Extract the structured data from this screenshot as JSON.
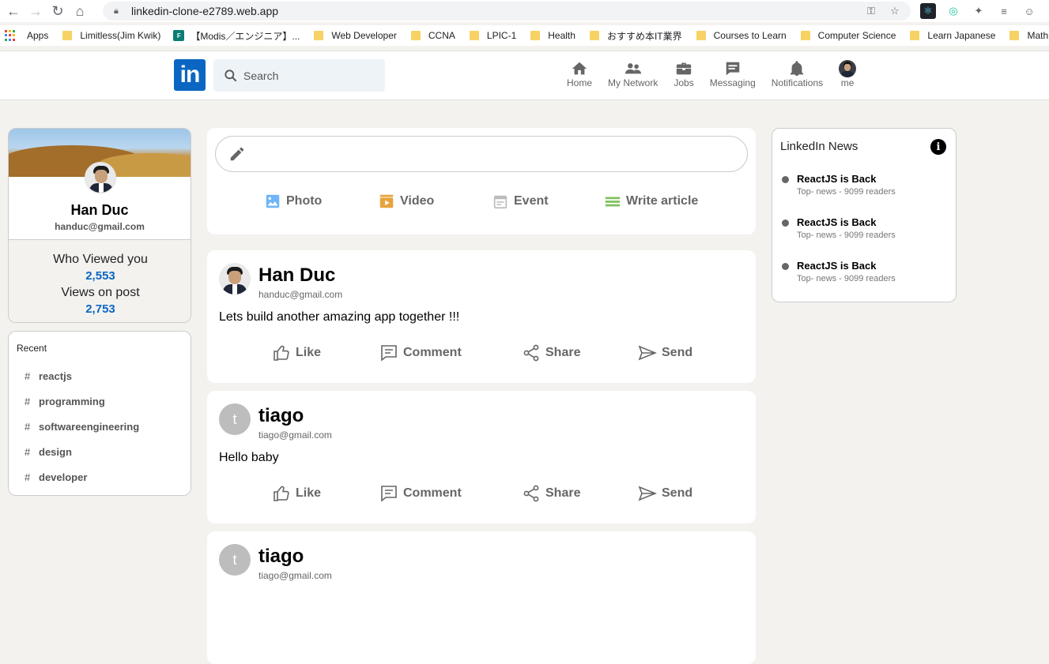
{
  "browser": {
    "url": "linkedin-clone-e2789.web.app",
    "bookmarks": [
      "Apps",
      "Limitless(Jim Kwik)",
      "【Modis／エンジニア】...",
      "Web Developer",
      "CCNA",
      "LPIC-1",
      "Health",
      "おすすめ本IT業界",
      "Courses to Learn",
      "Computer Science",
      "Learn Japanese",
      "Math"
    ]
  },
  "header": {
    "logo": "in",
    "search_placeholder": "Search",
    "nav": [
      {
        "label": "Home",
        "icon": "home-icon"
      },
      {
        "label": "My Network",
        "icon": "network-icon"
      },
      {
        "label": "Jobs",
        "icon": "briefcase-icon"
      },
      {
        "label": "Messaging",
        "icon": "message-icon"
      },
      {
        "label": "Notifications",
        "icon": "bell-icon"
      },
      {
        "label": "me",
        "icon": "avatar"
      }
    ]
  },
  "profile": {
    "name": "Han Duc",
    "email": "handuc@gmail.com",
    "who_viewed_label": "Who Viewed you",
    "who_viewed_count": "2,553",
    "views_label": "Views on post",
    "views_count": "2,753"
  },
  "recent": {
    "title": "Recent",
    "tags": [
      "reactjs",
      "programming",
      "softwareengineering",
      "design",
      "developer"
    ]
  },
  "composer": {
    "input_value": "",
    "options": [
      "Photo",
      "Video",
      "Event",
      "Write article"
    ]
  },
  "posts": [
    {
      "author": "Han Duc",
      "email": "handuc@gmail.com",
      "message": "Lets build another amazing app together !!!",
      "avatar_letter": ""
    },
    {
      "author": "tiago",
      "email": "tiago@gmail.com",
      "message": "Hello baby",
      "avatar_letter": "t"
    },
    {
      "author": "tiago",
      "email": "tiago@gmail.com",
      "message": "",
      "avatar_letter": "t"
    }
  ],
  "post_actions": [
    "Like",
    "Comment",
    "Share",
    "Send"
  ],
  "news": {
    "title": "LinkedIn News",
    "items": [
      {
        "heading": "ReactJS is Back",
        "sub": "Top- news - 9099 readers"
      },
      {
        "heading": "ReactJS is Back",
        "sub": "Top- news - 9099 readers"
      },
      {
        "heading": "ReactJS is Back",
        "sub": "Top- news - 9099 readers"
      }
    ]
  },
  "colors": {
    "brand": "#0a66c2",
    "background": "#f3f2ef"
  }
}
